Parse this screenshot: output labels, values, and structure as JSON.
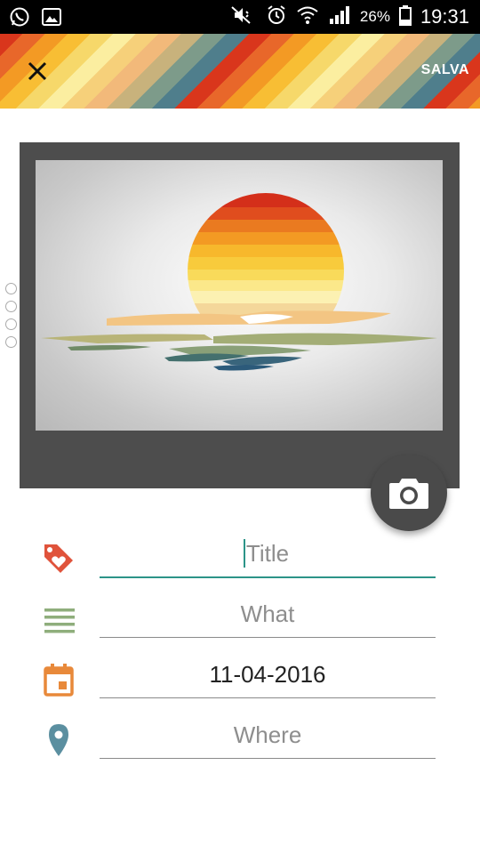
{
  "status_bar": {
    "battery_percent": "26%",
    "time": "19:31",
    "icons": [
      "whatsapp-icon",
      "gallery-icon",
      "mute-icon",
      "alarm-icon",
      "wifi-icon",
      "signal-icon",
      "battery-icon"
    ]
  },
  "header": {
    "close_icon": "close-icon",
    "save_label": "SALVA"
  },
  "image": {
    "description_icon": "sunset-illustration",
    "camera_icon": "camera-icon"
  },
  "form": {
    "title": {
      "placeholder": "Title",
      "value": "",
      "icon": "tag-heart-icon",
      "icon_color": "#e0533b"
    },
    "what": {
      "placeholder": "What",
      "value": "",
      "icon": "lines-icon",
      "icon_color": "#8fae7c"
    },
    "date": {
      "value": "11-04-2016",
      "icon": "calendar-icon",
      "icon_color": "#e8893a"
    },
    "where": {
      "placeholder": "Where",
      "value": "",
      "icon": "location-pin-icon",
      "icon_color": "#5b8fa0"
    }
  },
  "colors": {
    "accent": "#2c9488",
    "fab": "#4a4a4a"
  }
}
